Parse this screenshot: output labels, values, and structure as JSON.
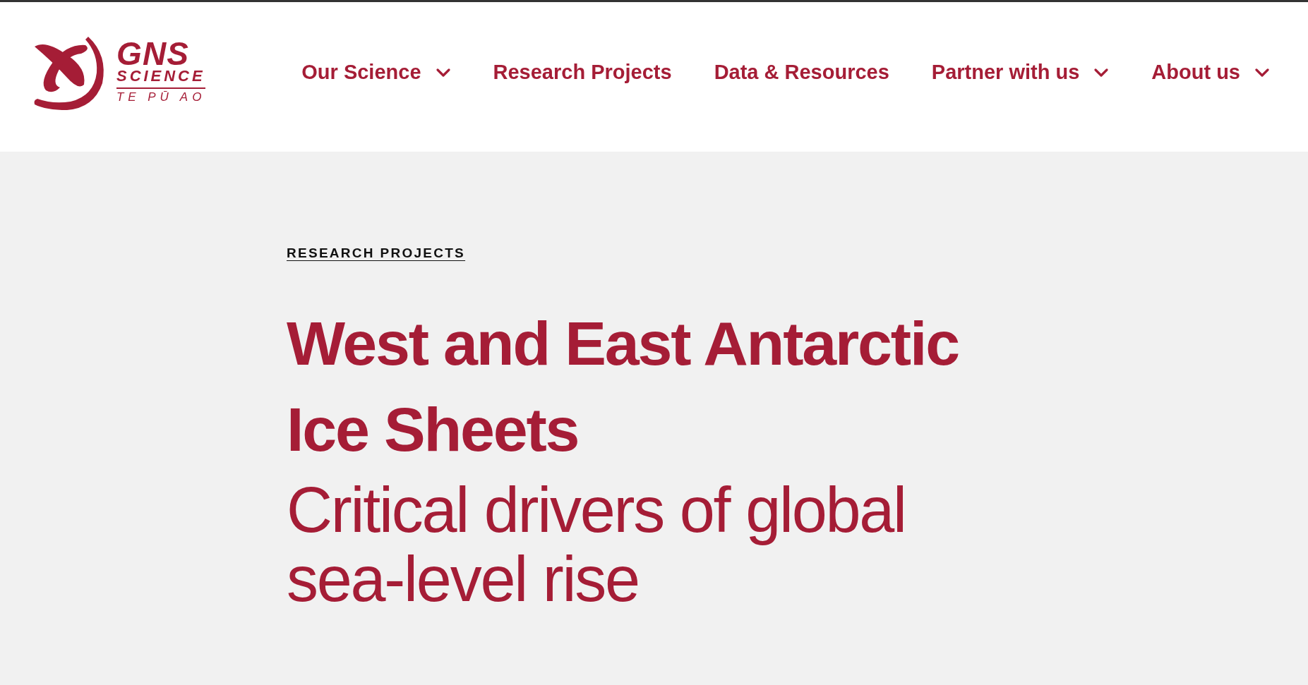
{
  "logo": {
    "name": "GNS",
    "line_2": "SCIENCE",
    "line_3": "TE PŪ AO"
  },
  "nav": [
    {
      "label": "Our Science",
      "has_menu": true
    },
    {
      "label": "Research Projects",
      "has_menu": false
    },
    {
      "label": "Data & Resources",
      "has_menu": false
    },
    {
      "label": "Partner with us",
      "has_menu": true
    },
    {
      "label": "About us",
      "has_menu": true
    }
  ],
  "breadcrumb": "RESEARCH PROJECTS",
  "title": "West and East Antarctic Ice Sheets",
  "subtitle": "Critical drivers of global sea-level rise"
}
